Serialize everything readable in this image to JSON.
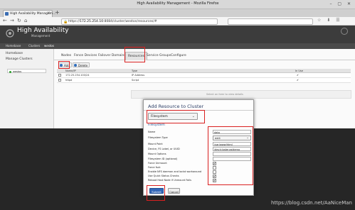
{
  "browser": {
    "window_title": "High Availability Management - Mozilla Firefox",
    "tab_title": "High Availability Managem...",
    "url_prefix": "https://",
    "url_host": "172.25.254.10",
    "url_path": ":8084/cluster/westos/resources/#",
    "back_icon": "arrow-left-icon",
    "forward_icon": "arrow-right-icon",
    "reload_icon": "reload-icon",
    "home_icon": "home-icon"
  },
  "app": {
    "title": "High Availability",
    "subtitle": "Management",
    "nav": [
      "Homebase",
      "Clusters",
      "westos"
    ]
  },
  "sidebar": {
    "links": [
      "Homebase",
      "Manage Clusters"
    ],
    "cluster_name": "westos",
    "cluster_status_color": "#2ea02e"
  },
  "main": {
    "tabs": [
      "Nodes",
      "Fence Devices",
      "Failover Domains",
      "Resources",
      "Service Groups",
      "Configure"
    ],
    "active_tab": "Resources",
    "toolbar": {
      "add": "Add",
      "delete": "Delete"
    },
    "table_headers": [
      "Name/IP",
      "Type",
      "In Use"
    ],
    "rows": [
      {
        "name": "172.25.254.100/24",
        "type": "IP Address",
        "in_use": "✔"
      },
      {
        "name": "httpd",
        "type": "Script",
        "in_use": "✔"
      }
    ],
    "detail_hint": "Select an item to view details"
  },
  "dialog": {
    "title": "Add Resource to Cluster",
    "type_value": "Filesystem",
    "section": "Filesystem",
    "fields": [
      {
        "label": "Name",
        "value": "data"
      },
      {
        "label": "Filesystem Type",
        "value": "ext4"
      },
      {
        "label": "Mount Point",
        "value": "/var/www/html"
      },
      {
        "label": "Device, FS Label, or UUID",
        "value": "/dev/clustervg/demo"
      },
      {
        "label": "Mount Options",
        "value": ""
      },
      {
        "label": "Filesystem ID (optional)",
        "value": ""
      }
    ],
    "checks": [
      {
        "label": "Force Unmount",
        "checked": "✔"
      },
      {
        "label": "Force fsck",
        "checked": ""
      },
      {
        "label": "Enable NFS daemon and lockd workaround",
        "checked": ""
      },
      {
        "label": "Use Quick Status Checks",
        "checked": "✔"
      },
      {
        "label": "Reboot Host Node if Unmount Fails",
        "checked": "✔"
      }
    ],
    "submit": "Submit",
    "cancel": "Cancel"
  },
  "watermark": "https://blog.csdn.net/AaNiceMan",
  "colors": {
    "annotation_red": "#d92020",
    "header_dark": "#3c3c3c",
    "overlay": "#262626",
    "submit_blue": "#3568b8"
  }
}
